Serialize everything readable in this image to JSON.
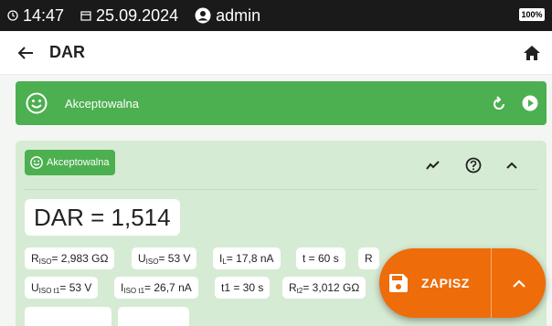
{
  "status_bar": {
    "time": "14:47",
    "date": "25.09.2024",
    "user": "admin",
    "battery": "100%"
  },
  "app_bar": {
    "title": "DAR"
  },
  "banner": {
    "label": "Akceptowalna",
    "color": "#4caf50"
  },
  "card": {
    "chip_label": "Akceptowalna",
    "result": "DAR = 1,514",
    "params": [
      {
        "main": "R",
        "sub": "ISO",
        "rest": " = 2,983 GΩ"
      },
      {
        "main": "U",
        "sub": "ISO",
        "rest": " = 53 V"
      },
      {
        "main": "I",
        "sub": "L",
        "rest": " = 17,8 nA"
      },
      {
        "main": "t = 60 s",
        "sub": "",
        "rest": ""
      },
      {
        "main": "R",
        "sub": "",
        "rest": ""
      },
      {
        "main": "U",
        "sub": "ISO t1",
        "rest": " = 53 V"
      },
      {
        "main": "I",
        "sub": "ISO t1",
        "rest": " = 26,7 nA"
      },
      {
        "main": "t1 = 30 s",
        "sub": "",
        "rest": ""
      },
      {
        "main": "R",
        "sub": "t2",
        "rest": " = 3,012 GΩ"
      }
    ]
  },
  "fab": {
    "save_label": "ZAPISZ",
    "color": "#ee6c0a"
  }
}
